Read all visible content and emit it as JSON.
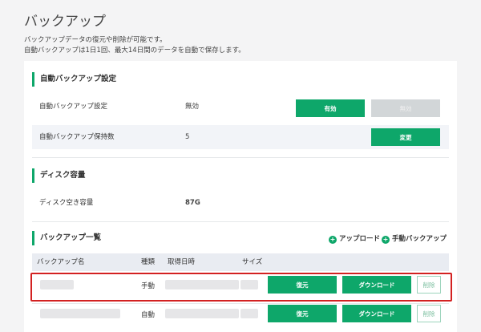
{
  "page": {
    "title": "バックアップ",
    "description_line1": "バックアップデータの復元や削除が可能です。",
    "description_line2": "自動バックアップは1日1回、最大14日間のデータを自動で保存します。"
  },
  "auto_backup": {
    "section_title": "自動バックアップ設定",
    "setting_label": "自動バックアップ設定",
    "setting_value": "無効",
    "enable_label": "有効",
    "disable_label": "無効",
    "retention_label": "自動バックアップ保持数",
    "retention_value": "5",
    "change_label": "変更"
  },
  "disk": {
    "section_title": "ディスク容量",
    "free_label": "ディスク空き容量",
    "free_value": "87G"
  },
  "backup_list": {
    "section_title": "バックアップ一覧",
    "upload_label": "アップロード",
    "manual_backup_label": "手動バックアップ",
    "columns": [
      "バックアップ名",
      "種類",
      "取得日時",
      "サイズ"
    ],
    "rows": [
      {
        "type": "手動",
        "restore_label": "復元",
        "download_label": "ダウンロード",
        "delete_label": "削除"
      },
      {
        "type": "自動",
        "restore_label": "復元",
        "download_label": "ダウンロード",
        "delete_label": "削除"
      }
    ]
  },
  "colors": {
    "accent": "#0ea76a",
    "highlight": "#d32121"
  },
  "icons": {
    "upload": "plus-circle-icon",
    "manual_backup": "plus-circle-icon"
  }
}
